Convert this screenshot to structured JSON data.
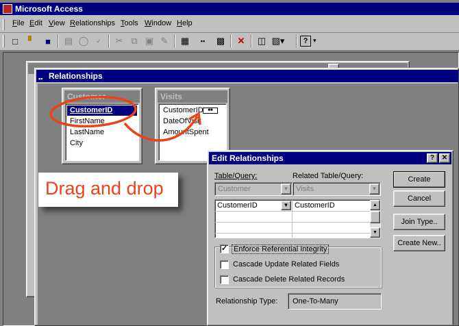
{
  "app": {
    "title": "Microsoft Access"
  },
  "menu": {
    "items": [
      "File",
      "Edit",
      "View",
      "Relationships",
      "Tools",
      "Window",
      "Help"
    ]
  },
  "toolbar": {
    "icons": [
      "new-icon",
      "open-icon",
      "save-icon",
      "print-icon",
      "print-preview-icon",
      "spelling-icon",
      "cut-icon",
      "copy-icon",
      "paste-icon",
      "format-painter-icon",
      "show-table-icon",
      "show-direct-icon",
      "show-all-icon",
      "delete-icon",
      "database-window-icon",
      "new-object-icon",
      "help-icon"
    ]
  },
  "relationships_window": {
    "title": "Relationships"
  },
  "tables": {
    "customer": {
      "title": "Customer",
      "fields": [
        "CustomerID",
        "FirstName",
        "LastName",
        "City"
      ]
    },
    "visits": {
      "title": "Visits",
      "fields": [
        "CustomerID",
        "DateOfVisit",
        "AmountSpent"
      ]
    }
  },
  "callout": {
    "text": "Drag and drop",
    "color": "#e8441a"
  },
  "dialog": {
    "title": "Edit Relationships",
    "table_query_label": "Table/Query:",
    "related_label": "Related Table/Query:",
    "table_value": "Customer",
    "related_value": "Visits",
    "rows": [
      {
        "left": "CustomerID",
        "right": "CustomerID"
      }
    ],
    "enforce_label": "Enforce Referential Integrity",
    "enforce_checked": true,
    "cascade_update_label": "Cascade Update Related Fields",
    "cascade_delete_label": "Cascade Delete Related Records",
    "relationship_type_label": "Relationship Type:",
    "relationship_type_value": "One-To-Many",
    "buttons": {
      "create": "Create",
      "cancel": "Cancel",
      "join_type": "Join Type..",
      "create_new": "Create New.."
    }
  }
}
